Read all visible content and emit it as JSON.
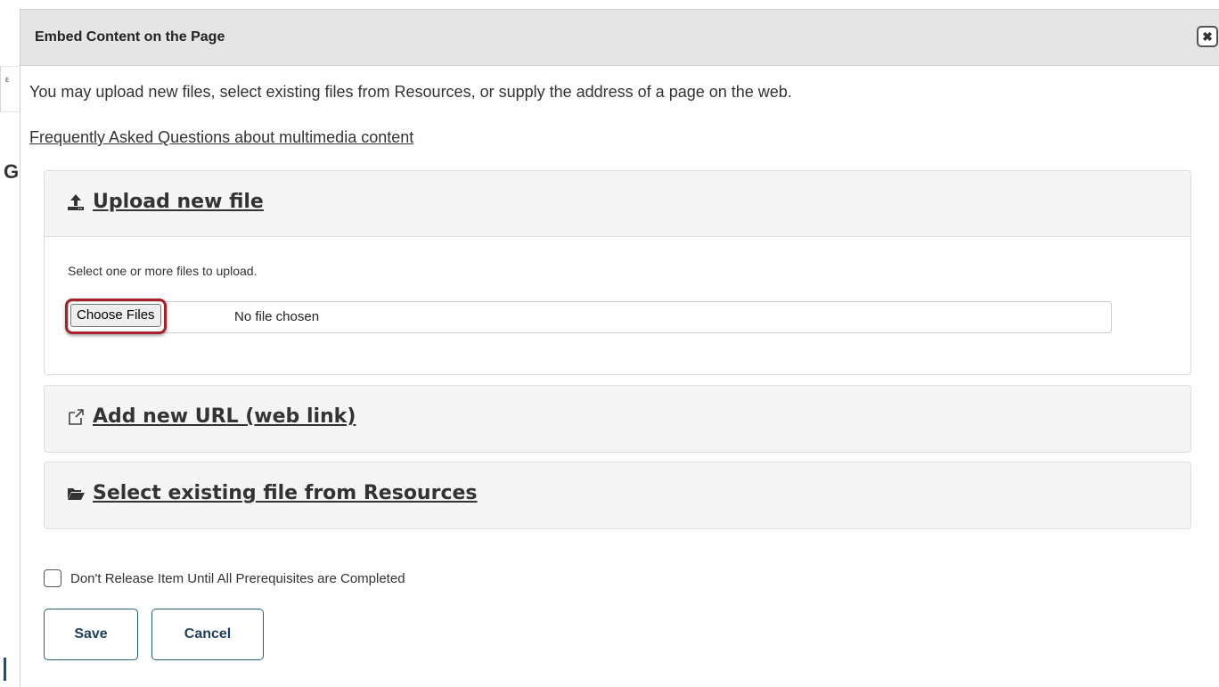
{
  "dialog": {
    "title": "Embed Content on the Page",
    "close_symbol": "✖",
    "intro": "You may upload new files, select existing files from Resources, or supply the address of a page on the web.",
    "faq_link": "Frequently Asked Questions about multimedia content"
  },
  "panels": {
    "upload": {
      "icon": "upload-icon",
      "label": "Upload new file",
      "hint": "Select one or more files to upload.",
      "choose_button": "Choose Files",
      "file_status": "No file chosen"
    },
    "url": {
      "icon": "external-link-icon",
      "label": "Add new URL (web link)"
    },
    "resources": {
      "icon": "folder-open-icon",
      "label": "Select existing file from Resources"
    }
  },
  "options": {
    "prerequisites_label": "Don't Release Item Until All Prerequisites are Completed",
    "prerequisites_checked": false
  },
  "actions": {
    "save_label": "Save",
    "cancel_label": "Cancel"
  },
  "colors": {
    "highlight": "#a8202a",
    "button_border": "#2d5f83",
    "titlebar_bg": "#e5e5e5"
  }
}
